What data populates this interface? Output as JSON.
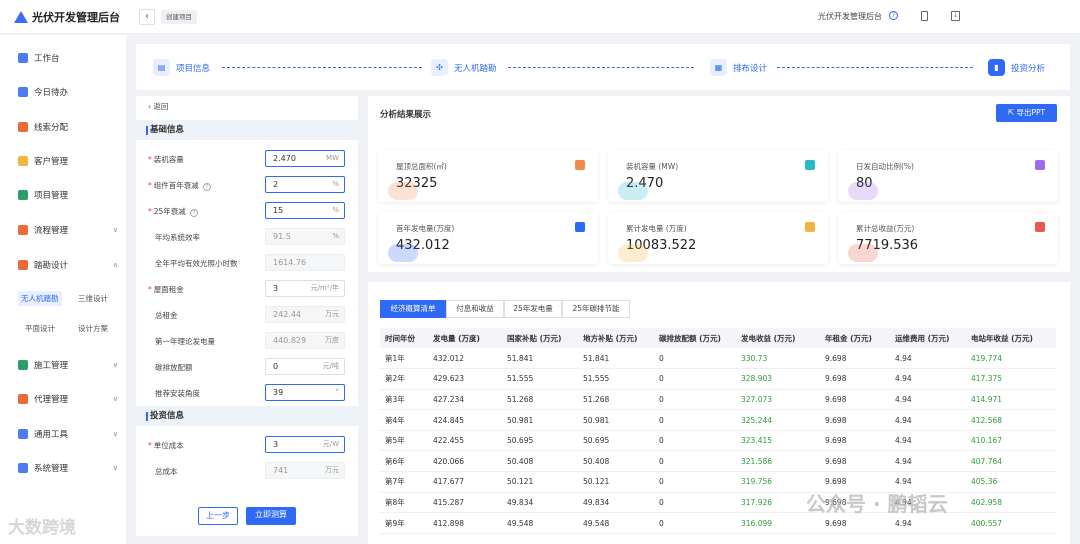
{
  "app": {
    "title": "光伏开发管理后台",
    "breadcrumb": "创建项目",
    "top_right_title": "光伏开发管理后台"
  },
  "sidebar": {
    "items": [
      {
        "label": "工作台",
        "icon": "home-icon"
      },
      {
        "label": "今日待办",
        "icon": "todo-icon"
      },
      {
        "label": "线索分配",
        "icon": "lead-icon"
      },
      {
        "label": "客户管理",
        "icon": "customer-icon"
      },
      {
        "label": "项目管理",
        "icon": "project-icon"
      },
      {
        "label": "流程管理",
        "icon": "flow-icon"
      },
      {
        "label": "踏勘设计",
        "icon": "survey-icon"
      },
      {
        "label": "施工管理",
        "icon": "construction-icon"
      },
      {
        "label": "代理管理",
        "icon": "agent-icon"
      },
      {
        "label": "通用工具",
        "icon": "tools-icon"
      },
      {
        "label": "系统管理",
        "icon": "settings-icon"
      }
    ],
    "sub_items": [
      "无人机踏勘",
      "三维设计",
      "平面设计",
      "设计方案"
    ]
  },
  "steps": [
    {
      "label": "项目信息"
    },
    {
      "label": "无人机踏勘"
    },
    {
      "label": "排布设计"
    },
    {
      "label": "投资分析"
    }
  ],
  "form": {
    "back": "返回",
    "section1": "基础信息",
    "section2": "投资信息",
    "fields": [
      {
        "label": "装机容量",
        "value": "2.470",
        "unit": "MW",
        "req": true
      },
      {
        "label": "组件首年衰减",
        "value": "2",
        "unit": "%",
        "req": true
      },
      {
        "label": "25年衰减",
        "value": "15",
        "unit": "%",
        "req": true
      },
      {
        "label": "年均系统效率",
        "value": "91.5",
        "unit": "%",
        "req": false
      },
      {
        "label": "全年平均有效光照小时数",
        "value": "1614.76",
        "unit": "",
        "req": false
      },
      {
        "label": "屋面租金",
        "value": "3",
        "unit": "元/m²/年",
        "req": true
      },
      {
        "label": "总租金",
        "value": "242.44",
        "unit": "万元",
        "req": false
      },
      {
        "label": "第一年理论发电量",
        "value": "440.829",
        "unit": "万度",
        "req": false
      },
      {
        "label": "碳排放配额",
        "value": "0",
        "unit": "元/吨",
        "req": false
      },
      {
        "label": "推荐安装角度",
        "value": "39",
        "unit": "°",
        "req": false
      },
      {
        "label": "单位成本",
        "value": "3",
        "unit": "元/W",
        "req": true
      },
      {
        "label": "总成本",
        "value": "741",
        "unit": "万元",
        "req": false
      }
    ],
    "prev_btn": "上一步",
    "calc_btn": "立即测算"
  },
  "results": {
    "title": "分析结果展示",
    "export": "导出PPT",
    "cards": [
      {
        "title": "屋顶总面积(㎡)",
        "value": "32325",
        "color": "#f08a4b"
      },
      {
        "title": "装机容量 (MW)",
        "value": "2.470",
        "color": "#2bb9c9"
      },
      {
        "title": "日发自动比例(%)",
        "value": "80",
        "color": "#9b6cf0"
      },
      {
        "title": "首年发电量(万度)",
        "value": "432.012",
        "color": "#2f6af5"
      },
      {
        "title": "累计发电量 (万度)",
        "value": "10083.522",
        "color": "#f2b640"
      },
      {
        "title": "累计总收益(万元)",
        "value": "7719.536",
        "color": "#ea5a4a"
      }
    ]
  },
  "tabs": [
    "经济概算清单",
    "付息和收益",
    "25年发电量",
    "25年碳排节能"
  ],
  "table": {
    "headers": [
      "时间年份",
      "发电量 (万度)",
      "国家补贴 (万元)",
      "地方补贴 (万元)",
      "碳排放配额 (万元)",
      "发电收益 (万元)",
      "年租金 (万元)",
      "运维费用 (万元)",
      "电站年收益 (万元)"
    ],
    "rows": [
      [
        "第1年",
        "432.012",
        "51.841",
        "51.841",
        "0",
        "330.73",
        "9.698",
        "4.94",
        "419.774"
      ],
      [
        "第2年",
        "429.623",
        "51.555",
        "51.555",
        "0",
        "328.903",
        "9.698",
        "4.94",
        "417.375"
      ],
      [
        "第3年",
        "427.234",
        "51.268",
        "51.268",
        "0",
        "327.073",
        "9.698",
        "4.94",
        "414.971"
      ],
      [
        "第4年",
        "424.845",
        "50.981",
        "50.981",
        "0",
        "325.244",
        "9.698",
        "4.94",
        "412.568"
      ],
      [
        "第5年",
        "422.455",
        "50.695",
        "50.695",
        "0",
        "323.415",
        "9.698",
        "4.94",
        "410.167"
      ],
      [
        "第6年",
        "420.066",
        "50.408",
        "50.408",
        "0",
        "321.586",
        "9.698",
        "4.94",
        "407.764"
      ],
      [
        "第7年",
        "417.677",
        "50.121",
        "50.121",
        "0",
        "319.756",
        "9.698",
        "4.94",
        "405.36"
      ],
      [
        "第8年",
        "415.287",
        "49.834",
        "49.834",
        "0",
        "317.926",
        "9.698",
        "4.94",
        "402.958"
      ],
      [
        "第9年",
        "412.898",
        "49.548",
        "49.548",
        "0",
        "316.099",
        "9.698",
        "4.94",
        "400.557"
      ]
    ]
  },
  "watermarks": [
    "大数跨境",
    "公众号 · 鹏韬云"
  ]
}
